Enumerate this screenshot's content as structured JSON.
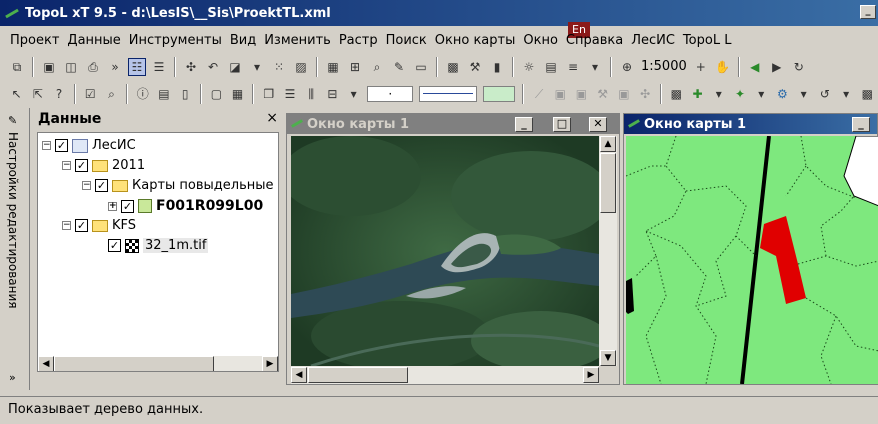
{
  "window": {
    "title": "TopoL xT 9.5 - d:\\LesIS\\__Sis\\ProektTL.xml",
    "minimize_label": "_"
  },
  "language_badge": "En",
  "menu": [
    "Проект",
    "Данные",
    "Инструменты",
    "Вид",
    "Изменить",
    "Растр",
    "Поиск",
    "Окно карты",
    "Окно",
    "Справка",
    "ЛесИС",
    "TopoL L"
  ],
  "toolbar": {
    "scale_value": "1:5000"
  },
  "side_tab": {
    "label": "Настройки редактирования"
  },
  "data_panel": {
    "title": "Данные",
    "close_label": "×",
    "tree": [
      {
        "label": "ЛесИС",
        "checked": true
      },
      {
        "label": "2011",
        "checked": true
      },
      {
        "label": "Карты повыдельные",
        "checked": true
      },
      {
        "label": "F001R099L00",
        "checked": true
      },
      {
        "label": "KFS",
        "checked": true
      },
      {
        "label": "32_1m.tif",
        "checked": true
      }
    ]
  },
  "map_window_1": {
    "title": "Окно карты 1",
    "minimize_label": "_",
    "maximize_label": "□",
    "close_label": "✕"
  },
  "map_window_2": {
    "title": "Окно карты 1",
    "minimize_label": "_"
  },
  "colors": {
    "accent": "#0a246a",
    "forest_polygon": "#7ee87e",
    "selected_polygon": "#e00000"
  },
  "status_bar": {
    "text": "Показывает дерево данных."
  }
}
